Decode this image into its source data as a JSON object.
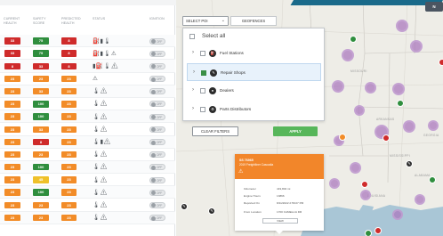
{
  "table": {
    "headers": {
      "current_health": "CURRENT HEALTH",
      "safety_score": "SAFETY SCORE",
      "predicted_health": "PREDICTED HEALTH",
      "status": "STATUS",
      "ignition": "IGNITION"
    },
    "toggle_label": "OFF",
    "rows": [
      {
        "health": "33",
        "health_color": "#cf2b2b",
        "safety": "75",
        "safety_color": "#2f8e3e",
        "predicted": "8",
        "predicted_color": "#cf2b2b",
        "status_icons": "⛽▮🌡"
      },
      {
        "health": "33",
        "health_color": "#cf2b2b",
        "safety": "79",
        "safety_color": "#2f8e3e",
        "predicted": "8",
        "predicted_color": "#cf2b2b",
        "status_icons": "⛽▮🌡⚠"
      },
      {
        "health": "8",
        "health_color": "#cf2b2b",
        "safety": "33",
        "safety_color": "#cf2b2b",
        "predicted": "8",
        "predicted_color": "#cf2b2b",
        "status_icons": "▮⛽🌡⚠"
      },
      {
        "health": "23",
        "health_color": "#f28c28",
        "safety": "23",
        "safety_color": "#f28c28",
        "predicted": "23",
        "predicted_color": "#f28c28",
        "status_icons": "⚠"
      },
      {
        "health": "23",
        "health_color": "#f28c28",
        "safety": "33",
        "safety_color": "#f28c28",
        "predicted": "23",
        "predicted_color": "#f28c28",
        "status_icons": "🌡⚠"
      },
      {
        "health": "23",
        "health_color": "#f28c28",
        "safety": "100",
        "safety_color": "#2f8e3e",
        "predicted": "23",
        "predicted_color": "#f28c28",
        "status_icons": "🌡⚠"
      },
      {
        "health": "23",
        "health_color": "#f28c28",
        "safety": "100",
        "safety_color": "#2f8e3e",
        "predicted": "23",
        "predicted_color": "#f28c28",
        "status_icons": "🌡⚠"
      },
      {
        "health": "23",
        "health_color": "#f28c28",
        "safety": "33",
        "safety_color": "#f28c28",
        "predicted": "23",
        "predicted_color": "#f28c28",
        "status_icons": "🌡⚠"
      },
      {
        "health": "23",
        "health_color": "#f28c28",
        "safety": "8",
        "safety_color": "#cf2b2b",
        "predicted": "23",
        "predicted_color": "#f28c28",
        "status_icons": "🌡▮⚠"
      },
      {
        "health": "23",
        "health_color": "#f28c28",
        "safety": "23",
        "safety_color": "#f28c28",
        "predicted": "23",
        "predicted_color": "#f28c28",
        "status_icons": "🌡⚠"
      },
      {
        "health": "23",
        "health_color": "#f28c28",
        "safety": "100",
        "safety_color": "#2f8e3e",
        "predicted": "23",
        "predicted_color": "#f28c28",
        "status_icons": "🌡⚠"
      },
      {
        "health": "23",
        "health_color": "#f28c28",
        "safety": "45",
        "safety_color": "#efc12a",
        "predicted": "23",
        "predicted_color": "#f28c28",
        "status_icons": "🌡⚠"
      },
      {
        "health": "23",
        "health_color": "#f28c28",
        "safety": "100",
        "safety_color": "#2f8e3e",
        "predicted": "23",
        "predicted_color": "#f28c28",
        "status_icons": "🌡⚠"
      },
      {
        "health": "23",
        "health_color": "#f28c28",
        "safety": "23",
        "safety_color": "#f28c28",
        "predicted": "23",
        "predicted_color": "#f28c28",
        "status_icons": "🌡⚠"
      },
      {
        "health": "23",
        "health_color": "#f28c28",
        "safety": "23",
        "safety_color": "#f28c28",
        "predicted": "23",
        "predicted_color": "#f28c28",
        "status_icons": "🌡⚠"
      }
    ]
  },
  "map": {
    "poi_select": "SELECT POI",
    "geofences_tab": "GEOFENCES",
    "select_all": "Select all",
    "poi_items": [
      {
        "label": "Fuel Stations",
        "checked": false,
        "selected": false,
        "icon": "fuel-icon"
      },
      {
        "label": "Repair Shops",
        "checked": true,
        "selected": true,
        "icon": "wrench-icon"
      },
      {
        "label": "Dealers",
        "checked": false,
        "selected": false,
        "icon": "dealer-icon"
      },
      {
        "label": "Parts Distributors",
        "checked": false,
        "selected": false,
        "icon": "parts-icon"
      }
    ],
    "clear_filters": "CLEAR FILTERS",
    "apply": "APPLY",
    "state_labels": [
      "MISSOURI",
      "ARKANSAS",
      "MISSISSIPPI",
      "ALABAMA",
      "LOUISIANA",
      "GEORGIA"
    ],
    "notification_count": "N"
  },
  "popup": {
    "title": "SS 76965",
    "subtitle": "2019 Freightliner Cascadia",
    "fields": [
      {
        "key": "Odometer",
        "value": "419,802 mi"
      },
      {
        "key": "Engine Hours",
        "value": "13866"
      },
      {
        "key": "Reported On",
        "value": "8/11/2022 2:56:07 PM"
      },
      {
        "key": "From Location",
        "value": "1700 CAMELLIA DR"
      }
    ],
    "view_label": "VIEW"
  }
}
